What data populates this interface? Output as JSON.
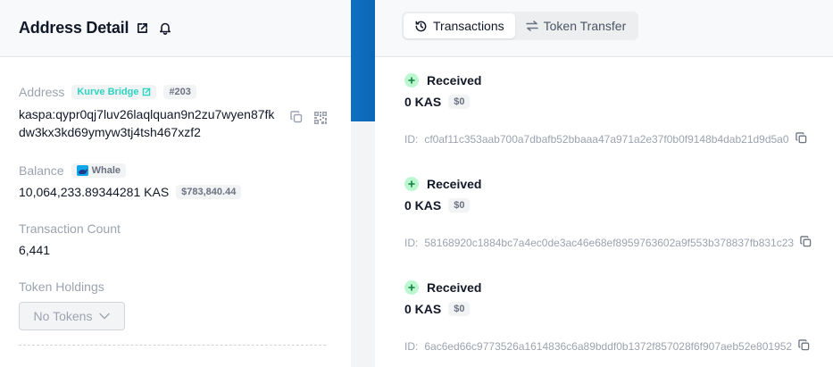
{
  "header": {
    "title": "Address Detail"
  },
  "address": {
    "label": "Address",
    "tag": "Kurve Bridge",
    "rank": "#203",
    "value": "kaspa:qypr0qj7luv26laqlquan9n2zu7wyen87fkdw3kx3kd69ymyw3tj4tsh467xzf2"
  },
  "balance": {
    "label": "Balance",
    "badge": "Whale",
    "value": "10,064,233.89344281 KAS",
    "usd": "$783,840.44"
  },
  "tx_count": {
    "label": "Transaction Count",
    "value": "6,441"
  },
  "tokens": {
    "label": "Token Holdings",
    "placeholder": "No Tokens"
  },
  "tabs": [
    {
      "label": "Transactions",
      "active": true
    },
    {
      "label": "Token Transfer",
      "active": false
    }
  ],
  "transactions": [
    {
      "type": "Received",
      "amount": "0 KAS",
      "usd": "$0",
      "id_label": "ID:",
      "id": "cf0af11c353aab700a7dbafb52bbaaa47a971a2e37f0b0f9148b4dab21d9d5a0"
    },
    {
      "type": "Received",
      "amount": "0 KAS",
      "usd": "$0",
      "id_label": "ID:",
      "id": "58168920c1884bc7a4ec0de3ac46e68ef8959763602a9f553b378837fb831c23"
    },
    {
      "type": "Received",
      "amount": "0 KAS",
      "usd": "$0",
      "id_label": "ID:",
      "id": "6ac6ed66c9773526a1614836c6a89bddf0b1372f857028f6f907aeb52e801952"
    }
  ],
  "colors": {
    "accent": "#2dd4bf",
    "received": "#bbf7d0",
    "stripe": "#0f6fc0"
  }
}
